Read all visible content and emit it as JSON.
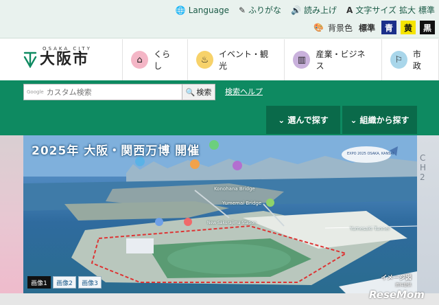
{
  "utility": {
    "language": "Language",
    "furigana": "ふりがな",
    "read_aloud": "読み上げ",
    "text_size_label": "文字サイズ",
    "text_size_options": [
      "拡大",
      "標準"
    ],
    "bg_color_label": "背景色",
    "bg_options": [
      {
        "label": "標準",
        "bg": "#e9f2ee",
        "fg": "#333333"
      },
      {
        "label": "青",
        "bg": "#1b2f8a",
        "fg": "#ffffff"
      },
      {
        "label": "黄",
        "bg": "#f5e400",
        "fg": "#111111"
      },
      {
        "label": "黒",
        "bg": "#111111",
        "fg": "#ffffff"
      }
    ]
  },
  "header": {
    "logo_en": "OSAKA CITY",
    "logo_jp": "大阪市",
    "nav": [
      {
        "label": "くらし",
        "icon": "house-icon",
        "color": "#f4b6c6",
        "glyph": "⌂"
      },
      {
        "label": "イベント・観光",
        "icon": "event-icon",
        "color": "#f7d26a",
        "glyph": "♨"
      },
      {
        "label": "産業・ビジネス",
        "icon": "building-icon",
        "color": "#c9b1dc",
        "glyph": "▥"
      },
      {
        "label": "市政",
        "icon": "city-hall-icon",
        "color": "#a9d6ea",
        "glyph": "⚐"
      }
    ]
  },
  "search": {
    "google_label": "Google",
    "placeholder": "カスタム検索",
    "button": "検索",
    "help": "検索ヘルプ"
  },
  "find": {
    "choose": "選んで探す",
    "org": "組織から探す"
  },
  "hero": {
    "title": "2025年 大阪・関西万博 開催",
    "labels": [
      "Konohana Bridge",
      "Yumemai Bridge",
      "Yumesaki Tunnel",
      "New Sakurajima Station"
    ],
    "blimp": "EXPO 2025 OSAKA, KANSAI",
    "image_tag": "イメージ図",
    "image_tag_sub": "資料提供",
    "tabs": [
      "画像1",
      "画像2",
      "画像3"
    ],
    "active_tab": 0
  },
  "side_right_chars": [
    "C",
    "H",
    "2"
  ],
  "watermark": "ReseMom",
  "colors": {
    "primary_green": "#0e8a61",
    "dark_green": "#0a6a4a",
    "utility_bg": "#e9f2ee"
  }
}
